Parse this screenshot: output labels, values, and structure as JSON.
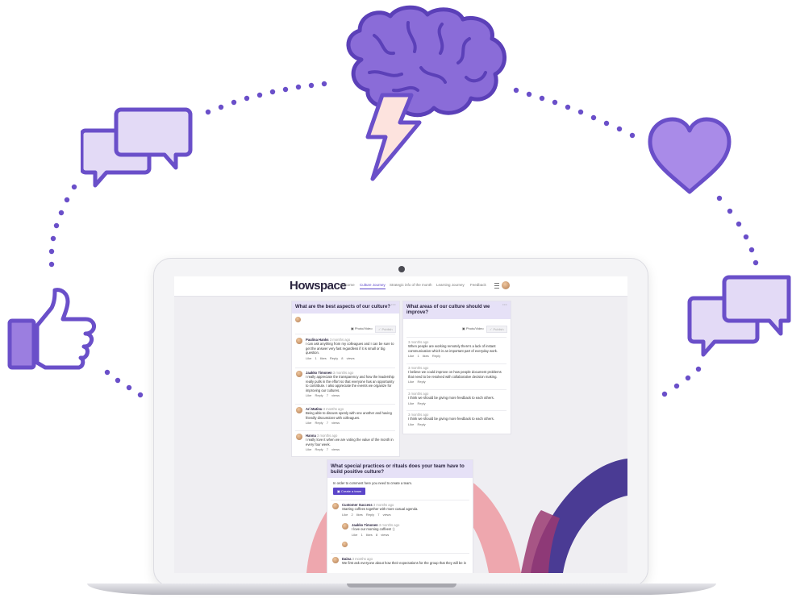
{
  "nav": {
    "logo": "Howspace",
    "items": [
      "Welcome",
      "Culture Journey",
      "Strategic info of the month",
      "Learning Journey",
      "Feedback"
    ],
    "active_index": 1
  },
  "panel_best": {
    "title": "What are the best aspects of our culture?",
    "photo_label": "Photo/Video",
    "publish_label": "✓ Publish",
    "comments": [
      {
        "name": "Paulina Hanks",
        "time": "3 months ago",
        "text": "I can ask anything from my colleagues and I can be sure to get the answer very fast regardless if it is small or big question.",
        "actions": "Like  1 likes  Reply  8 views"
      },
      {
        "name": "Jaakko Timonen",
        "time": "3 months ago",
        "text": "I really appreciate the transparency and how the leadership really pulls in the effort so that everyone has an opportunity to contribute. I also appreciate the events we organize for improving our cultures.",
        "actions": "Like  Reply  7 views"
      },
      {
        "name": "Ari Matinu",
        "time": "3 months ago",
        "text": "Being able to discuss openly with one another and having friendly discussions with colleagues.",
        "actions": "Like  Reply  7 views"
      },
      {
        "name": "Hanna",
        "time": "3 months ago",
        "text": "I really love it when we are voting the value of the month in every four week.",
        "actions": "Like  Reply  7 views"
      }
    ]
  },
  "panel_improve": {
    "title": "What areas of our culture should we improve?",
    "photo_label": "Photo/Video",
    "publish_label": "✓ Publish",
    "comments": [
      {
        "time": "3 months ago",
        "text": "When people are working remotely there's a lack of instant communication which is an important part of everyday work.",
        "actions": "Like  1 likes  Reply"
      },
      {
        "time": "3 months ago",
        "text": "I believe we could improve on how people document problems that need to be resolved with collaborative decision making.",
        "actions": "Like  Reply"
      },
      {
        "time": "3 months ago",
        "text": "I think we should be giving more feedback to each others.",
        "actions": "Like  Reply"
      },
      {
        "time": "3 months ago",
        "text": "I think we should be giving more feedback to each others.",
        "actions": "Like  Reply"
      }
    ]
  },
  "panel_rituals": {
    "title": "What special practices or rituals does your team have to build positive culture?",
    "notice": "In order to comment here you need to create a team.",
    "create_team_label": "Create a team",
    "comments": [
      {
        "name": "Customer Success",
        "time": "3 months ago",
        "text": "Starting coffees together with more casual agenda.",
        "actions": "Like  2 likes  Reply  7 views"
      },
      {
        "name": "Jaakko Timonen",
        "time": "3 months ago",
        "text": "I love our morning coffees! :)",
        "actions": "Like  1 likes  8 views"
      },
      {
        "name": "Daina",
        "time": "3 months ago",
        "text": "We first ask everyone about how their expectations for the group that they will be in",
        "actions": ""
      }
    ]
  },
  "colors": {
    "purple_icon": "#8a6cd8",
    "purple_dark": "#6a4fc9",
    "purple_light": "#e3daf6",
    "dots": "#6a4fc9",
    "bolt_fill": "#fde3de",
    "pink_arc": "#eea7ae",
    "indigo_arc": "#4a3b94",
    "accent": "#5b45c9"
  },
  "icons": [
    "chat-bubbles-icon",
    "brain-icon",
    "lightning-icon",
    "heart-icon",
    "thumbs-up-icon",
    "chat-bubbles-icon"
  ]
}
